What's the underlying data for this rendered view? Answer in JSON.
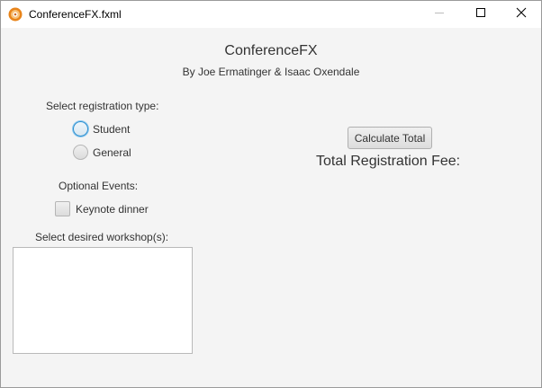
{
  "window": {
    "title": "ConferenceFX.fxml",
    "icon": "java-duke-icon",
    "minimize_icon": "minimize-icon",
    "maximize_icon": "maximize-icon",
    "close_icon": "close-icon"
  },
  "header": {
    "title": "ConferenceFX",
    "subtitle": "By Joe Ermatinger & Isaac Oxendale"
  },
  "registration": {
    "label": "Select registration type:",
    "options": [
      {
        "label": "Student",
        "selected": false,
        "focused": true
      },
      {
        "label": "General",
        "selected": false,
        "focused": false
      }
    ]
  },
  "optional": {
    "label": "Optional Events:",
    "keynote_label": "Keynote dinner",
    "keynote_checked": false
  },
  "workshops": {
    "label": "Select desired workshop(s):",
    "items": []
  },
  "actions": {
    "calculate_label": "Calculate Total",
    "total_label": "Total Registration Fee:"
  },
  "colors": {
    "focus_accent": "#2a8fd0",
    "app_icon_orange": "#e8841a",
    "background": "#f4f4f4"
  }
}
